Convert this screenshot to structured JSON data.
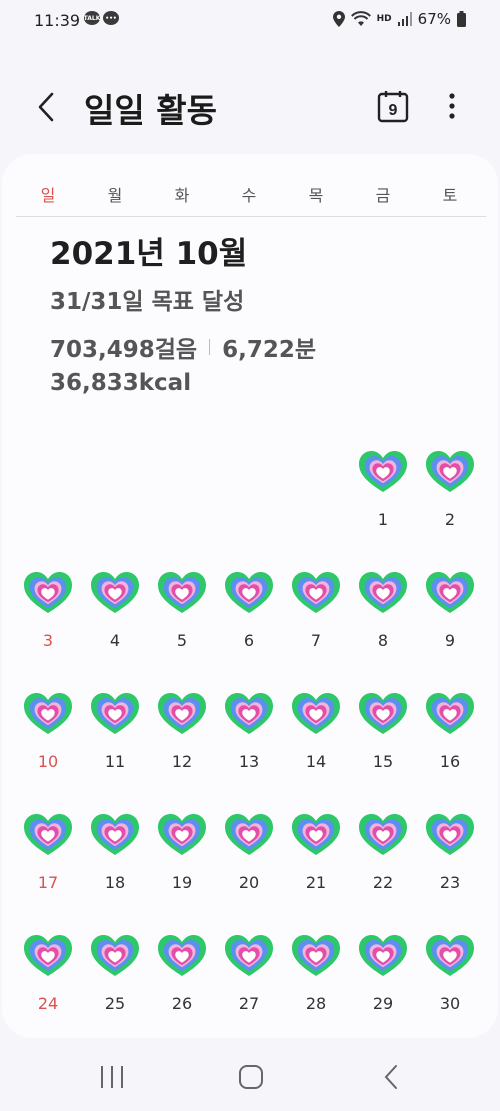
{
  "status_bar": {
    "time": "11:39",
    "battery": "67%",
    "hd_label": "HD",
    "notification_icons": [
      "kakaotalk-icon",
      "chat-bubble-icon"
    ],
    "kakao_label": "TALK"
  },
  "header": {
    "title": "일일 활동",
    "calendar_day": "9"
  },
  "weekdays": [
    "일",
    "월",
    "화",
    "수",
    "목",
    "금",
    "토"
  ],
  "summary": {
    "month": "2021년 10월",
    "goal": "31/31일 목표 달성",
    "steps": "703,498걸음",
    "minutes": "6,722분",
    "calories": "36,833kcal"
  },
  "calendar": {
    "first_weekday": 5,
    "days": [
      {
        "day": "1",
        "goal_met": true
      },
      {
        "day": "2",
        "goal_met": true
      },
      {
        "day": "3",
        "goal_met": true
      },
      {
        "day": "4",
        "goal_met": true
      },
      {
        "day": "5",
        "goal_met": true
      },
      {
        "day": "6",
        "goal_met": true
      },
      {
        "day": "7",
        "goal_met": true
      },
      {
        "day": "8",
        "goal_met": true
      },
      {
        "day": "9",
        "goal_met": true
      },
      {
        "day": "10",
        "goal_met": true
      },
      {
        "day": "11",
        "goal_met": true
      },
      {
        "day": "12",
        "goal_met": true
      },
      {
        "day": "13",
        "goal_met": true
      },
      {
        "day": "14",
        "goal_met": true
      },
      {
        "day": "15",
        "goal_met": true
      },
      {
        "day": "16",
        "goal_met": true
      },
      {
        "day": "17",
        "goal_met": true
      },
      {
        "day": "18",
        "goal_met": true
      },
      {
        "day": "19",
        "goal_met": true
      },
      {
        "day": "20",
        "goal_met": true
      },
      {
        "day": "21",
        "goal_met": true
      },
      {
        "day": "22",
        "goal_met": true
      },
      {
        "day": "23",
        "goal_met": true
      },
      {
        "day": "24",
        "goal_met": true
      },
      {
        "day": "25",
        "goal_met": true
      },
      {
        "day": "26",
        "goal_met": true
      },
      {
        "day": "27",
        "goal_met": true
      },
      {
        "day": "28",
        "goal_met": true
      },
      {
        "day": "29",
        "goal_met": true
      },
      {
        "day": "30",
        "goal_met": true
      }
    ]
  },
  "colors": {
    "sunday": "#d9534f",
    "ring_outer": "#2ec86a",
    "ring_middle": "#5c8ff0",
    "ring_inner": "#e34fa8",
    "background": "#f6f5fa",
    "card": "#fcfcfe"
  },
  "navbar": {
    "buttons": [
      "recent-apps-icon",
      "home-icon",
      "back-icon"
    ]
  }
}
